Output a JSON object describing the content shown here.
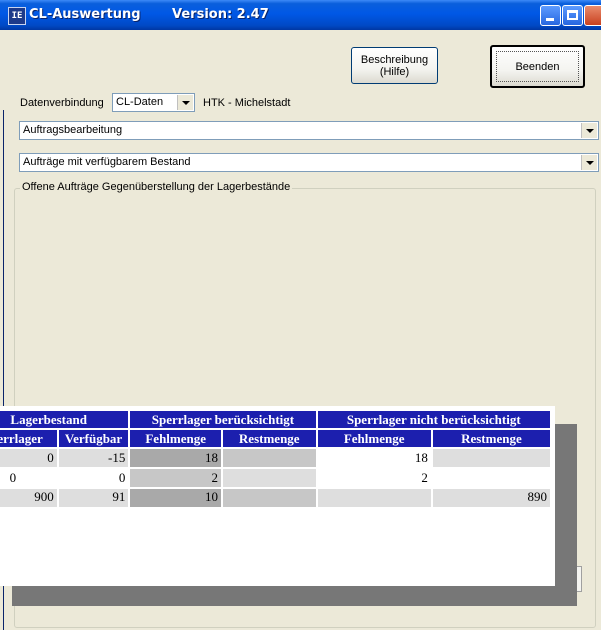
{
  "window": {
    "title": "CL-Auswertung",
    "version": "Version: 2.47",
    "app_icon": "app-icon"
  },
  "buttons": {
    "help": "Beschreibung\n(Hilfe)",
    "end": "Beenden"
  },
  "connection": {
    "label": "Datenverbindung",
    "value": "CL-Daten",
    "site": "HTK - Michelstadt"
  },
  "combos": {
    "module": "Auftragsbearbeitung",
    "report": "Aufträge mit verfügbarem Bestand"
  },
  "group": {
    "title": "Offene Aufträge Gegenüberstellung der Lagerbestände"
  },
  "table": {
    "group_headers": [
      "Lagerbestand",
      "Sperrlager berücksichtigt",
      "Sperrlager nicht berücksichtigt"
    ],
    "columns": [
      "Sperrlager",
      "Verfügbar",
      "Fehlmenge",
      "Restmenge",
      "Fehlmenge",
      "Restmenge"
    ],
    "rows": [
      [
        "0",
        "-15",
        "18",
        "",
        "18",
        ""
      ],
      [
        "0",
        "0",
        "2",
        "",
        "2",
        ""
      ],
      [
        "900",
        "91",
        "10",
        "",
        "",
        "890"
      ]
    ]
  },
  "colors": {
    "header_bg": "#1c1fae",
    "titlebar": "#0058e6",
    "window_bg": "#ece9d8"
  }
}
